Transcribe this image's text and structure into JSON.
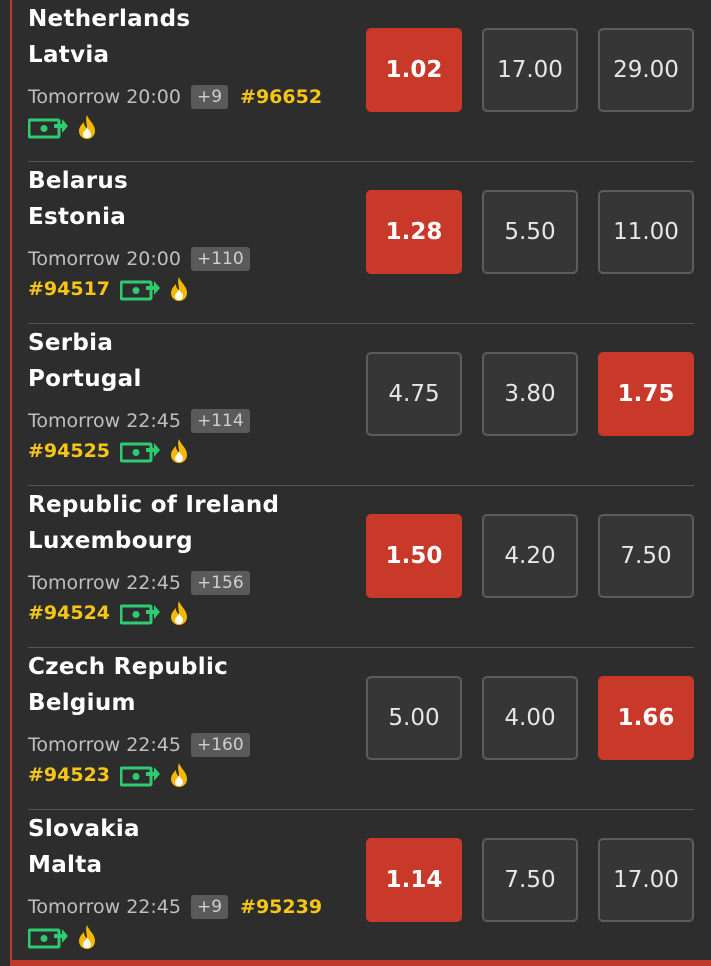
{
  "matches": [
    {
      "home": "Netherlands",
      "away": "Latvia",
      "time": "Tomorrow 20:00",
      "extra": "+9",
      "code": "#96652",
      "odds": [
        "1.02",
        "17.00",
        "29.00"
      ],
      "selected": 0
    },
    {
      "home": "Belarus",
      "away": "Estonia",
      "time": "Tomorrow 20:00",
      "extra": "+110",
      "code": "#94517",
      "odds": [
        "1.28",
        "5.50",
        "11.00"
      ],
      "selected": 0
    },
    {
      "home": "Serbia",
      "away": "Portugal",
      "time": "Tomorrow 22:45",
      "extra": "+114",
      "code": "#94525",
      "odds": [
        "4.75",
        "3.80",
        "1.75"
      ],
      "selected": 2
    },
    {
      "home": "Republic of Ireland",
      "away": "Luxembourg",
      "time": "Tomorrow 22:45",
      "extra": "+156",
      "code": "#94524",
      "odds": [
        "1.50",
        "4.20",
        "7.50"
      ],
      "selected": 0
    },
    {
      "home": "Czech Republic",
      "away": "Belgium",
      "time": "Tomorrow 22:45",
      "extra": "+160",
      "code": "#94523",
      "odds": [
        "5.00",
        "4.00",
        "1.66"
      ],
      "selected": 2
    },
    {
      "home": "Slovakia",
      "away": "Malta",
      "time": "Tomorrow 22:45",
      "extra": "+9",
      "code": "#95239",
      "odds": [
        "1.14",
        "7.50",
        "17.00"
      ],
      "selected": 0
    }
  ],
  "icons": {
    "cashout": "cash-out-icon",
    "hot": "fire-icon"
  },
  "colors": {
    "accent": "#c9392a",
    "code": "#f5c518",
    "cashout": "#2ecc71",
    "fire": "#f5b800"
  }
}
